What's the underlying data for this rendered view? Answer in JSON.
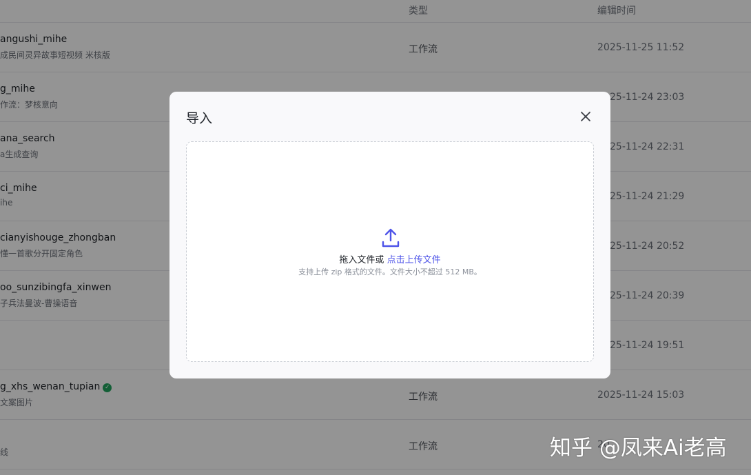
{
  "table": {
    "headers": {
      "type": "类型",
      "edit_time": "编辑时间"
    },
    "rows": [
      {
        "name": "angushi_mihe",
        "desc": "成民间灵异故事短视频 米核版",
        "type": "工作流",
        "time": "2025-11-25 11:52"
      },
      {
        "name": "g_mihe",
        "desc": "作流：梦核意向",
        "type": "",
        "time": "25-11-24 23:03"
      },
      {
        "name": "ana_search",
        "desc": "a生成查询",
        "type": "",
        "time": "25-11-24 22:31"
      },
      {
        "name": "ci_mihe",
        "desc": "ihe",
        "type": "",
        "time": "25-11-24 21:29"
      },
      {
        "name": "cianyishouge_zhongban",
        "desc": "懂一首歌分开固定角色",
        "type": "",
        "time": "25-11-24 20:52"
      },
      {
        "name": "oo_sunzibingfa_xinwen",
        "desc": "子兵法曼波-曹操语音",
        "type": "",
        "time": "25-11-24 20:39"
      },
      {
        "name": "",
        "desc": "",
        "type": "",
        "time": "25-11-24 19:51"
      },
      {
        "name": "g_xhs_wenan_tupian",
        "desc": "文案图片",
        "type": "工作流",
        "time": "2025-11-24 15:03",
        "verified": true
      },
      {
        "name": "",
        "desc": "线",
        "type": "工作流",
        "time": "20"
      }
    ]
  },
  "modal": {
    "title": "导入",
    "close_icon": "close-icon",
    "dropzone": {
      "icon": "upload-icon",
      "prompt": "拖入文件或",
      "link": "点击上传文件",
      "hint": "支持上传 zip 格式的文件。文件大小不超过 512 MB。"
    }
  },
  "watermark": "知乎 @凤来Ai老高",
  "colors": {
    "accent": "#4d53e8",
    "verified": "#22a45d"
  }
}
